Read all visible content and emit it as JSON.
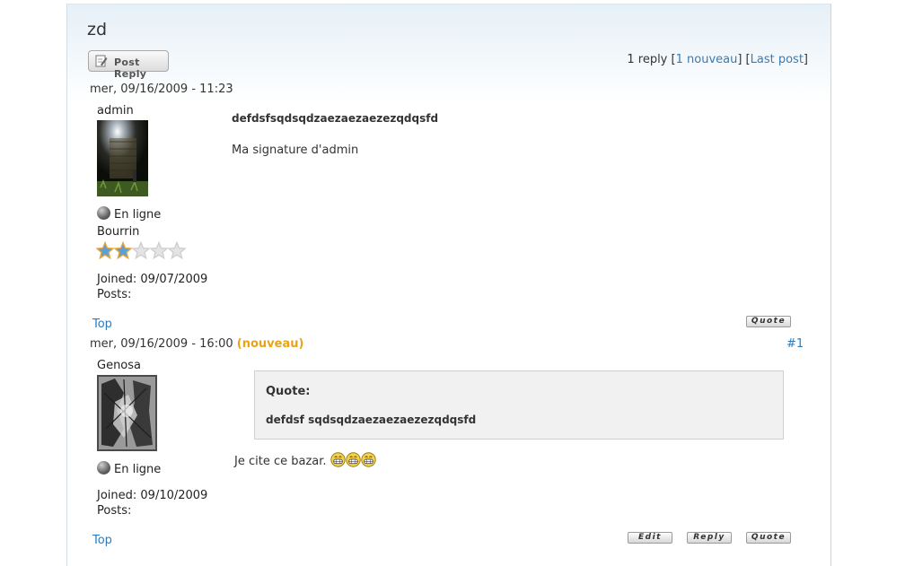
{
  "topic": {
    "title": "zd"
  },
  "toolbar": {
    "post_reply_label": "Post Reply"
  },
  "summary": {
    "count_text": "1 reply",
    "new_link": "1 nouveau",
    "last_link": "Last post"
  },
  "posts": [
    {
      "date": "mer, 09/16/2009 - 11:23",
      "author": "admin",
      "status": "En ligne",
      "rank": "Bourrin",
      "rating": 2,
      "rating_max": 5,
      "joined": "Joined: 09/07/2009",
      "posts": "Posts:",
      "body_title": "defdsfsqdsqdzaezaezaezezqdqsfd",
      "signature": "Ma signature d'admin",
      "top_link": "Top",
      "quote_button": "Quote"
    },
    {
      "date": "mer, 09/16/2009 - 16:00",
      "new_badge": "(nouveau)",
      "permalink": "#1",
      "author": "Genosa",
      "status": "En ligne",
      "joined": "Joined: 09/10/2009",
      "posts": "Posts:",
      "quote_label": "Quote:",
      "quote_text": "defdsf sqdsqdzaezaezaezezqdqsfd",
      "body": "Je cite ce bazar.",
      "smiley_count": 3,
      "top_link": "Top",
      "edit_button": "Edit",
      "reply_button": "Reply",
      "quote_button": "Quote"
    }
  ],
  "colors": {
    "link": "#2a7bbd",
    "new_badge": "#e8a415",
    "star_filled": "#5b9fd6",
    "star_outline": "#e6a63a"
  }
}
